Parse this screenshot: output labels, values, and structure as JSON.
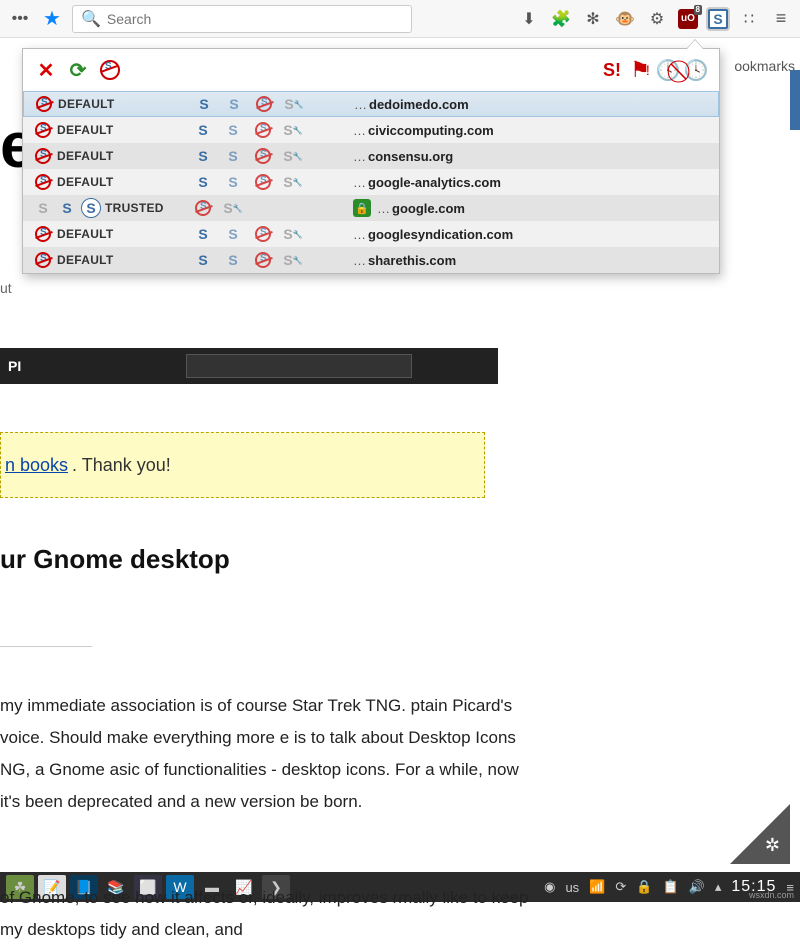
{
  "toolbar": {
    "search_placeholder": "Search",
    "ublock_badge": "8"
  },
  "bookmarks_label": "ookmarks",
  "popup": {
    "rows": [
      {
        "perm": "DEFAULT",
        "domain": "dedoimedo.com",
        "trusted": false
      },
      {
        "perm": "DEFAULT",
        "domain": "civiccomputing.com",
        "trusted": false
      },
      {
        "perm": "DEFAULT",
        "domain": "consensu.org",
        "trusted": false
      },
      {
        "perm": "DEFAULT",
        "domain": "google-analytics.com",
        "trusted": false
      },
      {
        "perm": "TRUSTED",
        "domain": "google.com",
        "trusted": true
      },
      {
        "perm": "DEFAULT",
        "domain": "googlesyndication.com",
        "trusted": false
      },
      {
        "perm": "DEFAULT",
        "domain": "sharethis.com",
        "trusted": false
      }
    ],
    "ellipsis": "…"
  },
  "page": {
    "e": "e",
    "ut": "ut",
    "pi": "PI",
    "books_link": "n books",
    "books_thanks": ". Thank you!",
    "h1": "ur Gnome desktop",
    "p1": " my immediate association is of course Star Trek TNG. ptain Picard's voice. Should make everything more e is to talk about Desktop Icons NG, a Gnome asic of functionalities - desktop icons. For a while,  now it's been deprecated and a new version be born.",
    "p2": " of Gnome, to see how it affects or, ideally, improves rmally like to keep my desktops tidy and clean, and"
  },
  "tray": {
    "kb": "us",
    "clock": "15:15"
  },
  "watermark": "wsxdn.com"
}
